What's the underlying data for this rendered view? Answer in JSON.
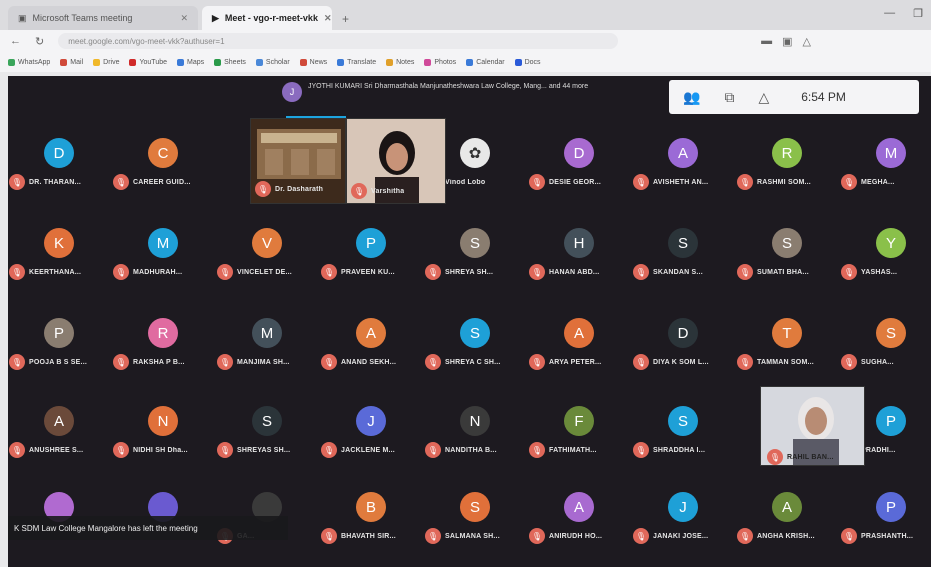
{
  "browser": {
    "tabs": [
      {
        "label": "Microsoft Teams meeting"
      },
      {
        "label": "Meet - vgo-r-meet-vkk"
      }
    ],
    "url": "meet.google.com/vgo-meet-vkk?authuser=1",
    "bookmarks": [
      "WhatsApp",
      "Mail",
      "Drive",
      "YouTube",
      "Maps",
      "Sheets",
      "Scholar",
      "News",
      "Translate",
      "Notes",
      "Photos",
      "Calendar",
      "Docs"
    ]
  },
  "meeting": {
    "joiner_avatar": "J",
    "joiner_text": "JYOTHI KUMARI Sri Dharmasthala Manjunatheshwara Law College, Mang... and 44 more",
    "clock": "6:54 PM",
    "toast": "K SDM Law College Mangalore has left the meeting",
    "self_name": "Dr. Dasharath",
    "video_names": [
      "Varshitha",
      "RAHIL BAN..."
    ],
    "guest_name": "Vinod Lobo"
  },
  "participants": [
    [
      {
        "i": "D",
        "name": "DR. THARAN...",
        "c": "#1ea0d7"
      },
      {
        "i": "C",
        "name": "CAREER GUID...",
        "c": "#e07b3d"
      },
      {
        "i": "",
        "name": "",
        "c": ""
      },
      {
        "i": "",
        "name": "",
        "c": ""
      },
      {
        "i": "img",
        "name": "Vinod Lobo",
        "c": ""
      },
      {
        "i": "D",
        "name": "DESIE GEOR...",
        "c": "#a86ad0"
      },
      {
        "i": "A",
        "name": "AVISHETH AN...",
        "c": "#9b6ad6"
      },
      {
        "i": "R",
        "name": "RASHMI SOM...",
        "c": "#8ac04a"
      },
      {
        "i": "M",
        "name": "MEGHA...",
        "c": "#9b6ad6"
      }
    ],
    [
      {
        "i": "K",
        "name": "KEERTHANA...",
        "c": "#e0703a"
      },
      {
        "i": "M",
        "name": "MADHURAH...",
        "c": "#1ea0d7"
      },
      {
        "i": "V",
        "name": "VINCELET DE...",
        "c": "#e07b3d"
      },
      {
        "i": "P",
        "name": "PRAVEEN KU...",
        "c": "#1ea0d7"
      },
      {
        "i": "S",
        "name": "SHREYA SH...",
        "c": "#8a7d70"
      },
      {
        "i": "H",
        "name": "HANAN ABD...",
        "c": "#43505a"
      },
      {
        "i": "S",
        "name": "SKANDAN S...",
        "c": "#2b3439"
      },
      {
        "i": "S",
        "name": "SUMATI BHA...",
        "c": "#8a7d70"
      },
      {
        "i": "Y",
        "name": "YASHAS...",
        "c": "#8ac04a"
      }
    ],
    [
      {
        "i": "P",
        "name": "POOJA B S SE...",
        "c": "#8a7d70"
      },
      {
        "i": "R",
        "name": "RAKSHA P B...",
        "c": "#e06ba0"
      },
      {
        "i": "M",
        "name": "MANJIMA SH...",
        "c": "#43505a"
      },
      {
        "i": "A",
        "name": "ANAND SEKH...",
        "c": "#e07b3d"
      },
      {
        "i": "S",
        "name": "SHREYA C SH...",
        "c": "#1ea0d7"
      },
      {
        "i": "A",
        "name": "ARYA PETER...",
        "c": "#e0703a"
      },
      {
        "i": "D",
        "name": "DIYA K SOM L...",
        "c": "#2b3439"
      },
      {
        "i": "T",
        "name": "TAMMAN SOM...",
        "c": "#e07b3d"
      },
      {
        "i": "S",
        "name": "SUGHA...",
        "c": "#e07b3d"
      }
    ],
    [
      {
        "i": "A",
        "name": "ANUSHREE S...",
        "c": "#6b4a3a"
      },
      {
        "i": "N",
        "name": "NIDHI SH Dha...",
        "c": "#e0703a"
      },
      {
        "i": "S",
        "name": "SHREYAS SH...",
        "c": "#2b3439"
      },
      {
        "i": "J",
        "name": "JACKLENE M...",
        "c": "#5a6ad8"
      },
      {
        "i": "N",
        "name": "NANDITHA B...",
        "c": "#3a3a3a"
      },
      {
        "i": "F",
        "name": "FATHIMATH...",
        "c": "#6a8a3a"
      },
      {
        "i": "S",
        "name": "SHRADDHA I...",
        "c": "#1ea0d7"
      },
      {
        "i": "",
        "name": "",
        "c": ""
      },
      {
        "i": "P",
        "name": "PRADHI...",
        "c": "#1ea0d7"
      }
    ],
    [
      {
        "i": "",
        "name": "",
        "c": "#b06ad0"
      },
      {
        "i": "",
        "name": "",
        "c": "#6a5ad0"
      },
      {
        "i": "",
        "name": "GA...",
        "c": "#3a3a3a"
      },
      {
        "i": "B",
        "name": "BHAVATH SIR...",
        "c": "#e07b3d"
      },
      {
        "i": "S",
        "name": "SALMANA SH...",
        "c": "#e0703a"
      },
      {
        "i": "A",
        "name": "ANIRUDH HO...",
        "c": "#a86ad0"
      },
      {
        "i": "J",
        "name": "JANAKI JOSE...",
        "c": "#1ea0d7"
      },
      {
        "i": "A",
        "name": "ANGHA KRISH...",
        "c": "#6a8a3a"
      },
      {
        "i": "P",
        "name": "PRASHANTH...",
        "c": "#5a6ad8"
      }
    ]
  ]
}
